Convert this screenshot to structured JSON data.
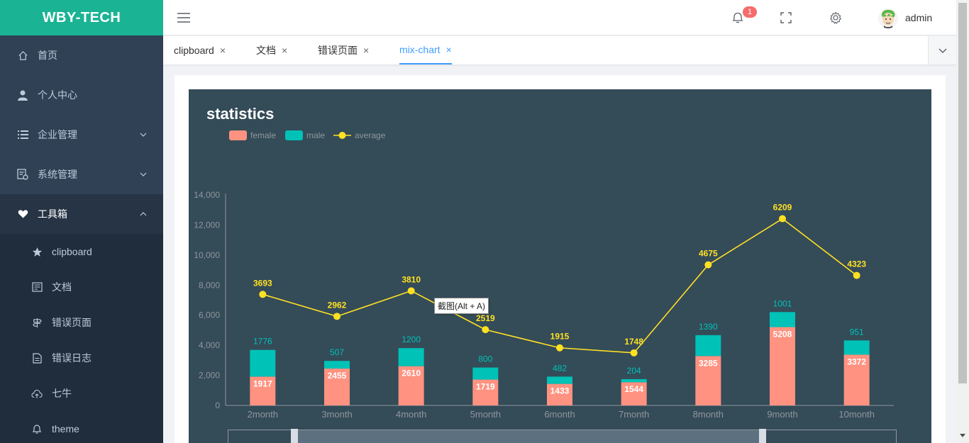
{
  "sidebar": {
    "logo": "WBY-TECH",
    "items": [
      {
        "label": "首页",
        "icon": "home-icon"
      },
      {
        "label": "个人中心",
        "icon": "user-icon"
      },
      {
        "label": "企业管理",
        "icon": "list-icon"
      },
      {
        "label": "系统管理",
        "icon": "system-icon"
      },
      {
        "label": "工具箱",
        "icon": "heart-icon"
      }
    ],
    "subitems": [
      {
        "label": "clipboard",
        "icon": "star-icon"
      },
      {
        "label": "文档",
        "icon": "document-icon"
      },
      {
        "label": "错误页面",
        "icon": "signpost-icon"
      },
      {
        "label": "错误日志",
        "icon": "log-icon"
      },
      {
        "label": "七牛",
        "icon": "cloud-upload-icon"
      },
      {
        "label": "theme",
        "icon": "bell-icon"
      }
    ]
  },
  "header": {
    "notification_count": "1",
    "username": "admin"
  },
  "tabs": [
    {
      "label": "clipboard",
      "close": "×"
    },
    {
      "label": "文档",
      "close": "×"
    },
    {
      "label": "错误页面",
      "close": "×"
    },
    {
      "label": "mix-chart",
      "close": "×"
    }
  ],
  "tooltip": "截图(Alt + A)",
  "chart_data": {
    "type": "bar",
    "title": "statistics",
    "categories": [
      "2month",
      "3month",
      "4month",
      "5month",
      "6month",
      "7month",
      "8month",
      "9month",
      "10month"
    ],
    "series": [
      {
        "name": "female",
        "type": "bar",
        "stack": true,
        "color": "#ff9280",
        "values": [
          1917,
          2455,
          2610,
          1719,
          1433,
          1544,
          3285,
          5208,
          3372
        ]
      },
      {
        "name": "male",
        "type": "bar",
        "stack": true,
        "color": "#00c2b7",
        "values": [
          1776,
          507,
          1200,
          800,
          482,
          204,
          1390,
          1001,
          951
        ]
      },
      {
        "name": "average",
        "type": "line",
        "color": "#ffe123",
        "values": [
          3693,
          2962,
          3810,
          2519,
          1915,
          1748,
          4675,
          6209,
          4323
        ]
      }
    ],
    "ylim": [
      0,
      14000
    ],
    "yticks": [
      "0",
      "2,000",
      "4,000",
      "6,000",
      "8,000",
      "10,000",
      "12,000",
      "14,000"
    ],
    "legend": "top-left",
    "grid": false
  }
}
